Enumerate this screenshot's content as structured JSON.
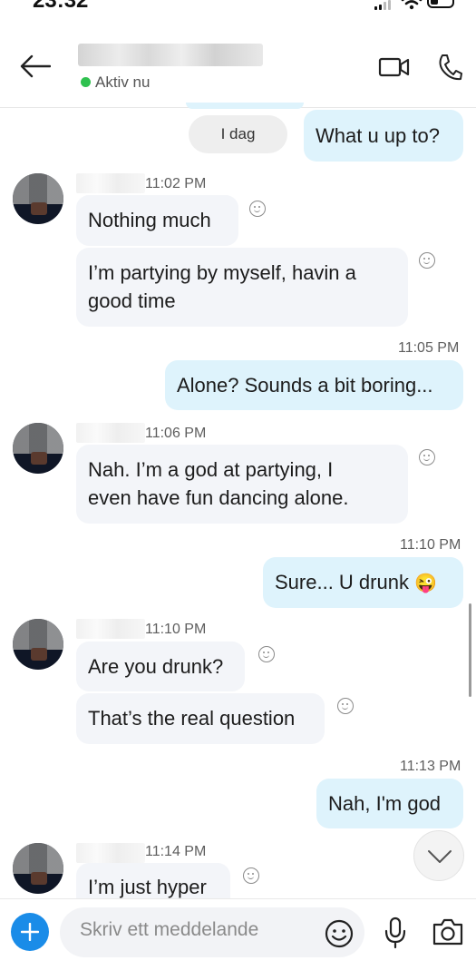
{
  "status_bar": {
    "time": "23:32"
  },
  "header": {
    "contact_status": "Aktiv nu"
  },
  "chat": {
    "day_label": "I dag",
    "first_out": "What u up to?",
    "group1": {
      "time": "11:02 PM",
      "msg1": "Nothing much",
      "msg2_line1": "I’m partying by myself, havin a",
      "msg2_line2": "good time"
    },
    "out2": {
      "time": "11:05 PM",
      "text": "Alone? Sounds a bit boring..."
    },
    "group2": {
      "time": "11:06 PM",
      "line1": "Nah. I’m a god at partying, I",
      "line2": "even have fun dancing alone."
    },
    "out3": {
      "time": "11:10 PM",
      "text": "Sure... U drunk",
      "emoji": "😜"
    },
    "group3": {
      "time": "11:10 PM",
      "msg1": "Are you drunk?",
      "msg2": "That’s the real question"
    },
    "out4": {
      "time": "11:13 PM",
      "text": "Nah, I'm god"
    },
    "group4": {
      "time": "11:14 PM",
      "msg1": "I’m just hyper"
    }
  },
  "composer": {
    "placeholder": "Skriv ett meddelande"
  },
  "colors": {
    "accent": "#1a8ce8",
    "outgoing_bubble": "#def3fc",
    "incoming_bubble": "#f3f5f9",
    "online": "#2fc14f"
  }
}
